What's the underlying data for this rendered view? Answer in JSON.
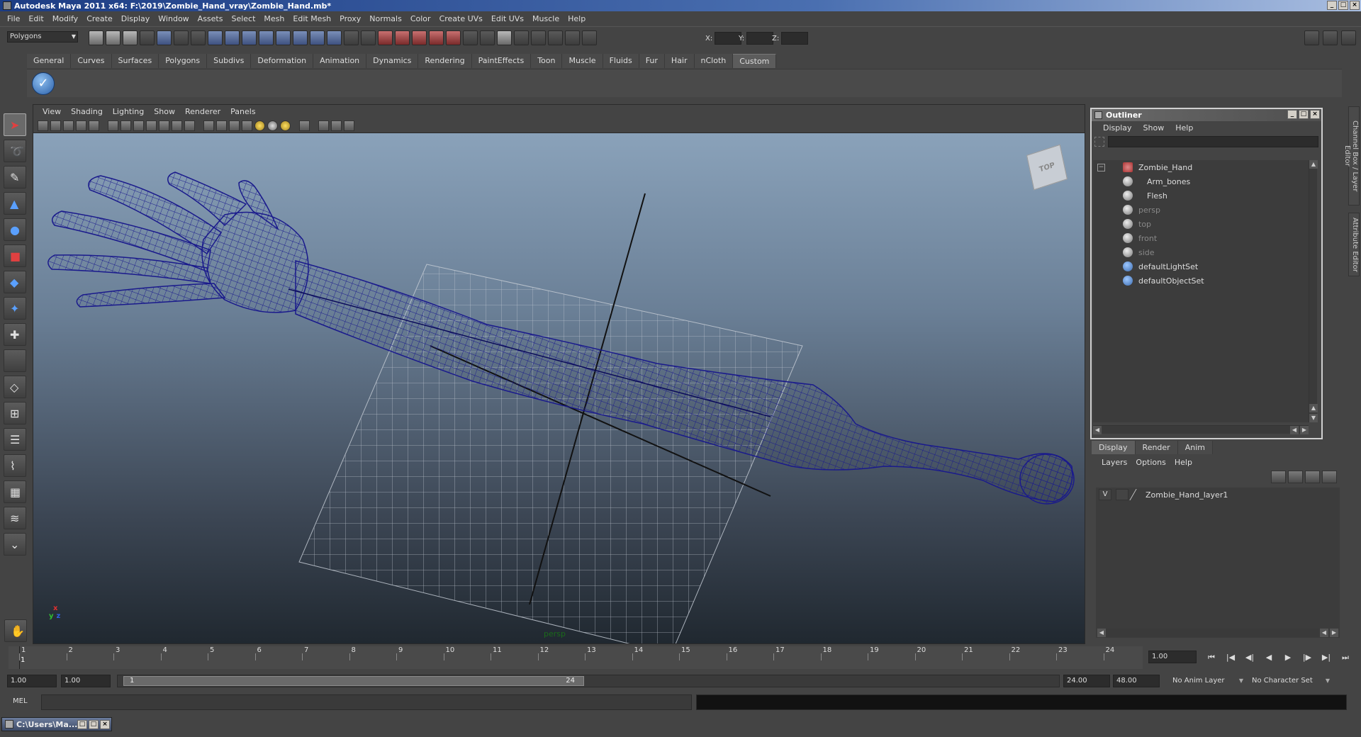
{
  "window": {
    "title": "Autodesk Maya 2011 x64: F:\\2019\\Zombie_Hand_vray\\Zombie_Hand.mb*"
  },
  "menu": [
    "File",
    "Edit",
    "Modify",
    "Create",
    "Display",
    "Window",
    "Assets",
    "Select",
    "Mesh",
    "Edit Mesh",
    "Proxy",
    "Normals",
    "Color",
    "Create UVs",
    "Edit UVs",
    "Muscle",
    "Help"
  ],
  "statusline": {
    "mode": "Polygons",
    "x_label": "X:",
    "y_label": "Y:",
    "z_label": "Z:"
  },
  "shelf": {
    "tabs": [
      "General",
      "Curves",
      "Surfaces",
      "Polygons",
      "Subdivs",
      "Deformation",
      "Animation",
      "Dynamics",
      "Rendering",
      "PaintEffects",
      "Toon",
      "Muscle",
      "Fluids",
      "Fur",
      "Hair",
      "nCloth",
      "Custom"
    ],
    "active_tab": "Custom"
  },
  "viewport": {
    "menu": [
      "View",
      "Shading",
      "Lighting",
      "Show",
      "Renderer",
      "Panels"
    ],
    "viewcube_label": "TOP",
    "camera": "persp",
    "axis": {
      "x": "x",
      "y": "y",
      "z": "z"
    }
  },
  "outliner": {
    "title": "Outliner",
    "menu": [
      "Display",
      "Show",
      "Help"
    ],
    "items": [
      {
        "label": "Zombie_Hand",
        "dim": false
      },
      {
        "label": "Arm_bones",
        "dim": false
      },
      {
        "label": "Flesh",
        "dim": false
      },
      {
        "label": "persp",
        "dim": true
      },
      {
        "label": "top",
        "dim": true
      },
      {
        "label": "front",
        "dim": true
      },
      {
        "label": "side",
        "dim": true
      },
      {
        "label": "defaultLightSet",
        "dim": false
      },
      {
        "label": "defaultObjectSet",
        "dim": false
      }
    ]
  },
  "layer_editor": {
    "tabs": [
      "Display",
      "Render",
      "Anim"
    ],
    "active_tab": "Display",
    "menu": [
      "Layers",
      "Options",
      "Help"
    ],
    "layers": [
      {
        "visible": "V",
        "name": "Zombie_Hand_layer1"
      }
    ]
  },
  "side_tabs": [
    "Channel Box / Layer Editor",
    "Attribute Editor"
  ],
  "timeslider": {
    "ticks": [
      1,
      2,
      3,
      4,
      5,
      6,
      7,
      8,
      9,
      10,
      11,
      12,
      13,
      14,
      15,
      16,
      17,
      18,
      19,
      20,
      21,
      22,
      23,
      24
    ],
    "current_frame": "1",
    "current_field": "1.00"
  },
  "range": {
    "start": "1.00",
    "start2": "1.00",
    "thumb_start": "1",
    "thumb_end": "24",
    "end": "24.00",
    "end2": "48.00",
    "anim_layer": "No Anim Layer",
    "char_set": "No Character Set"
  },
  "cmdline": {
    "label": "MEL"
  },
  "taskbar": {
    "window_label": "C:\\Users\\Ma..."
  },
  "colors": {
    "wireframe": "#1a1a8c",
    "grid": "#bfc6cf",
    "accent": "#2a5fa8"
  }
}
